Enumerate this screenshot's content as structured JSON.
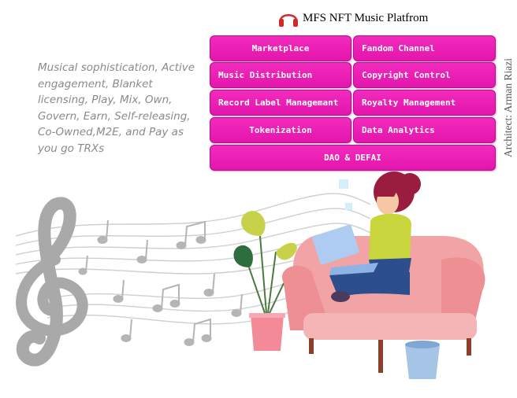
{
  "header": {
    "title": "MFS NFT Music  Platfrom",
    "logo_icon": "headphones-icon"
  },
  "tagline": "Musical sophistication, Active engagement, Blanket licensing, Play, Mix, Own, Govern, Earn, Self-releasing, Co-Owned,M2E, and Pay as you go TRXs",
  "tiles": {
    "marketplace": "Marketplace",
    "fandom_channel": "Fandom Channel",
    "music_distribution": "Music Distribution",
    "copyright_control": "Copyright Control",
    "record_label": "Record Label Managemant",
    "royalty_management": "Royalty Management",
    "tokenization": "Tokenization",
    "data_analytics": "Data Analytics",
    "dao_defai": "DAO & DEFAI"
  },
  "architect": "Architect: Arman Riazi",
  "colors": {
    "tile": "#e91ab2",
    "tile_border": "#b0108a",
    "tagline_text": "#8a8a8a",
    "sofa": "#f2a3a6"
  }
}
